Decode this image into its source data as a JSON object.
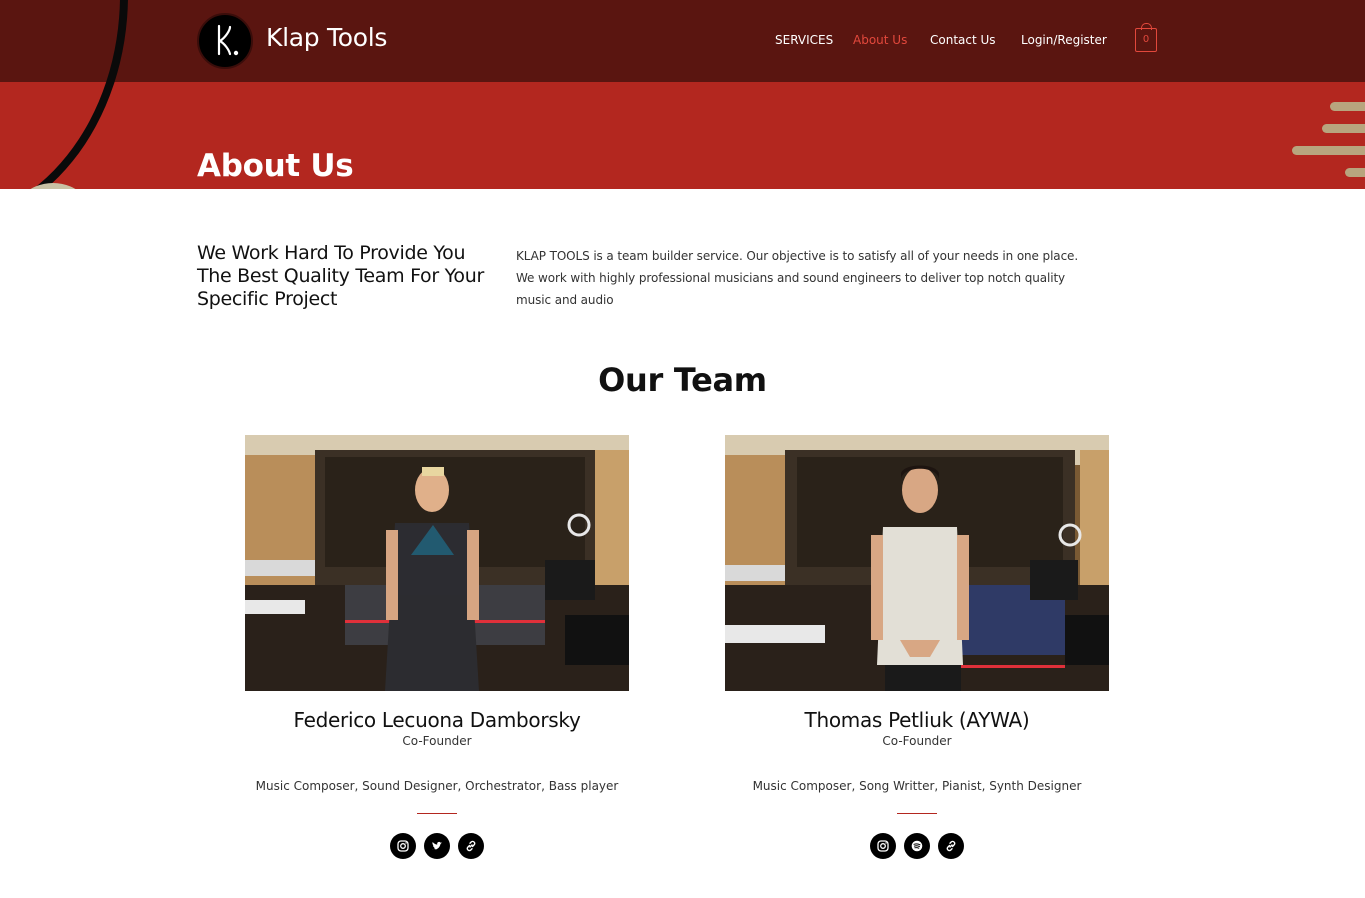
{
  "header": {
    "brand": "Klap Tools",
    "nav": [
      {
        "label": "SERVICES",
        "active": false
      },
      {
        "label": "About Us",
        "active": true
      },
      {
        "label": "Contact Us",
        "active": false
      },
      {
        "label": "Login/Register",
        "active": false
      }
    ],
    "cart_count": "0"
  },
  "hero": {
    "title": "About Us"
  },
  "intro": {
    "heading": "We Work Hard To Provide You The Best Quality Team For Your Specific Project",
    "text": "KLAP TOOLS is a team builder service. Our objective is to satisfy all of your needs in one place. We work with highly professional musicians and sound engineers to deliver top notch quality music and audio"
  },
  "team": {
    "title": "Our Team",
    "members": [
      {
        "name": "Federico Lecuona Damborsky",
        "role": "Co-Founder",
        "description": "Music Composer, Sound Designer, Orchestrator, Bass player",
        "socials": [
          "instagram-icon",
          "twitter-icon",
          "link-icon"
        ]
      },
      {
        "name": "Thomas Petliuk (AYWA)",
        "role": "Co-Founder",
        "description": "Music Composer, Song Writter, Pianist, Synth Designer",
        "socials": [
          "instagram-icon",
          "spotify-icon",
          "link-icon"
        ]
      }
    ]
  },
  "colors": {
    "header_bg": "#5a1510",
    "hero_bg": "#b3271f",
    "accent": "#e2483c"
  }
}
